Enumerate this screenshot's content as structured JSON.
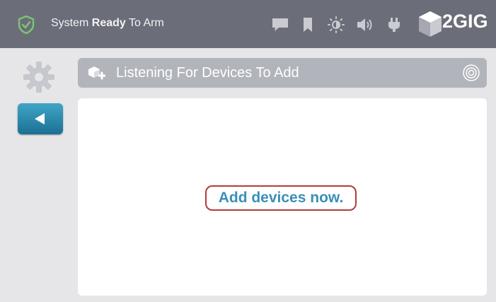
{
  "status_bar": {
    "status_prefix": "System ",
    "status_bold": "Ready",
    "status_suffix": " To Arm",
    "icons": [
      "shield-check-icon",
      "message-icon",
      "bookmark-icon",
      "brightness-icon",
      "volume-icon",
      "power-plug-icon"
    ],
    "brand": "2GIG"
  },
  "sidebar": {
    "icons": [
      "gear-icon",
      "back-arrow-icon"
    ]
  },
  "header": {
    "title": "Listening For Devices To Add",
    "icons": [
      "device-add-icon",
      "radio-listening-icon"
    ]
  },
  "main": {
    "message": "Add devices now."
  },
  "colors": {
    "top_bar": "#6b6e78",
    "accent_blue": "#3a8fb7",
    "highlight_red": "#b43b39",
    "shield_green": "#7cc576"
  }
}
